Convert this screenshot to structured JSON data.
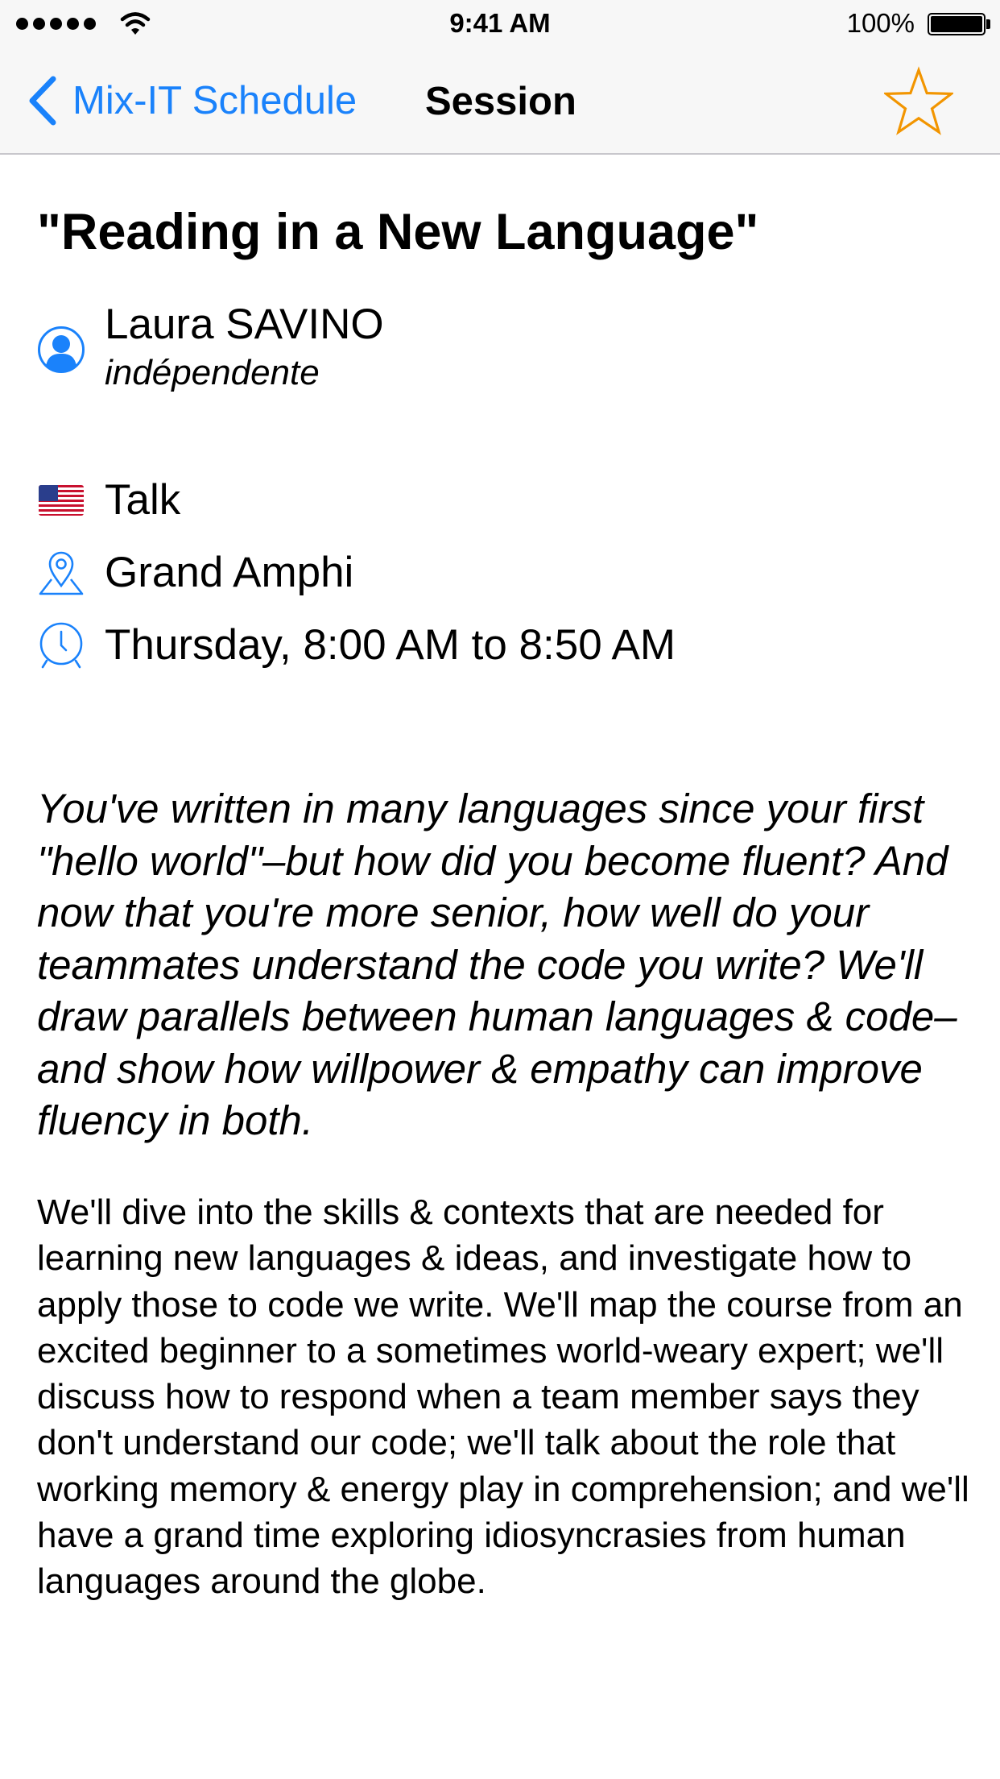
{
  "status_bar": {
    "time": "9:41 AM",
    "battery": "100%",
    "signal_icon": "signal-dots-icon",
    "wifi_icon": "wifi-icon"
  },
  "nav": {
    "back_label": "Mix-IT Schedule",
    "title": "Session",
    "back_icon": "chevron-left-icon",
    "favorite_icon": "star-outline-icon",
    "accent_color": "#1a82fb",
    "star_color": "#f29500"
  },
  "session": {
    "title": "\"Reading in a New Language\"",
    "speaker": {
      "name": "Laura SAVINO",
      "company": "indépendente",
      "icon": "person-icon"
    },
    "format": {
      "label": "Talk",
      "icon": "us-flag-icon"
    },
    "room": {
      "label": "Grand Amphi",
      "icon": "location-pin-icon"
    },
    "time": {
      "label": "Thursday, 8:00 AM to 8:50 AM",
      "icon": "clock-icon"
    },
    "abstract": "You've written in many languages since your first \"hello world\"–but how did you become fluent? And now that you're more senior, how well do your teammates understand the code you write? We'll draw parallels between human languages & code–and show how willpower & empathy can improve fluency in both.",
    "description": "We'll dive into the skills & contexts that are needed for learning new languages & ideas, and investigate how to apply those to code we write. We'll map the course from an excited beginner to a sometimes world-weary expert; we'll discuss how to respond when a team member says they don't understand our code; we'll talk about the role that working memory & energy play in comprehension; and we'll have a grand time exploring idiosyncrasies from human languages around the globe."
  }
}
